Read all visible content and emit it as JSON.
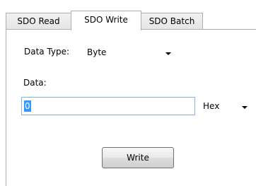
{
  "tabs": [
    {
      "label": "SDO Read",
      "active": false
    },
    {
      "label": "SDO Write",
      "active": true
    },
    {
      "label": "SDO Batch",
      "active": false
    }
  ],
  "form": {
    "data_type_label": "Data Type:",
    "data_type_value": "Byte",
    "data_label": "Data:",
    "data_value": "0",
    "format_value": "Hex",
    "write_button_label": "Write"
  }
}
